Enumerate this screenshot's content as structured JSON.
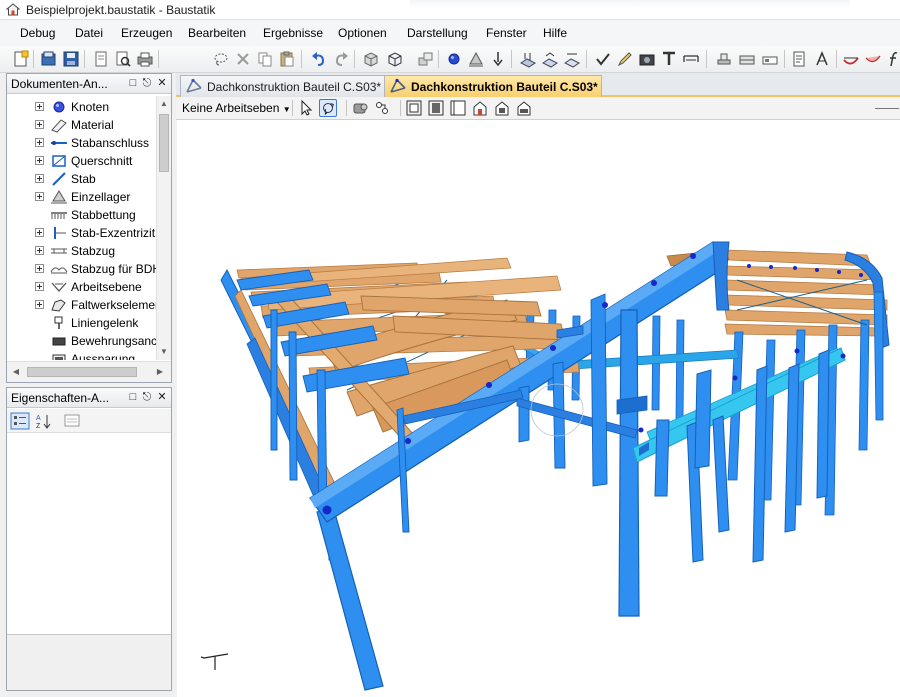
{
  "window": {
    "title": "Beispielprojekt.baustatik - Baustatik"
  },
  "menu": {
    "items": [
      "Debug",
      "Datei",
      "Erzeugen",
      "Bearbeiten",
      "Ergebnisse",
      "Optionen",
      "Darstellung",
      "Fenster",
      "Hilfe"
    ]
  },
  "toolbar": {
    "icons": [
      "new-icon",
      "open-icon",
      "save-icon",
      "page-icon",
      "print-preview-icon",
      "print-icon",
      "lasso-icon",
      "delete-icon",
      "copy-icon",
      "paste-icon",
      "undo-icon",
      "redo-icon",
      "box-icon",
      "view-cube-icon",
      "move-icon",
      "node-icon",
      "support-icon",
      "load-icon",
      "load-area-icon",
      "checkmark-icon",
      "pen-icon",
      "camera-icon",
      "text-icon",
      "dimension-icon",
      "plate-icon",
      "frame-icon",
      "document-icon",
      "design-icon",
      "curve-icon",
      "function-icon"
    ]
  },
  "document_panel": {
    "title": "Dokumenten-An...",
    "items": [
      {
        "label": "Knoten",
        "icon": "node-icon"
      },
      {
        "label": "Material",
        "icon": "material-icon"
      },
      {
        "label": "Stabanschluss",
        "icon": "member-end-icon"
      },
      {
        "label": "Querschnitt",
        "icon": "cross-section-icon"
      },
      {
        "label": "Stab",
        "icon": "member-icon"
      },
      {
        "label": "Einzellager",
        "icon": "single-support-icon"
      },
      {
        "label": "Stabbettung",
        "icon": "member-bedding-icon"
      },
      {
        "label": "Stab-Exzentrizit",
        "icon": "member-eccentricity-icon"
      },
      {
        "label": "Stabzug",
        "icon": "member-chain-icon"
      },
      {
        "label": "Stabzug für BDH",
        "icon": "member-chain-bdh-icon"
      },
      {
        "label": "Arbeitsebene",
        "icon": "work-plane-icon"
      },
      {
        "label": "Faltwerkselemen",
        "icon": "folded-plate-icon"
      },
      {
        "label": "Liniengelenk",
        "icon": "line-hinge-icon"
      },
      {
        "label": "Bewehrungsanc",
        "icon": "reinforcement-icon"
      },
      {
        "label": "Aussparung",
        "icon": "opening-icon"
      }
    ]
  },
  "properties_panel": {
    "title": "Eigenschaften-A...",
    "buttons": [
      "categorized-icon",
      "sort-az-icon",
      "property-pages-icon"
    ]
  },
  "tabs": [
    {
      "label": "Dachkonstruktion Bauteil C.S03*",
      "active": false
    },
    {
      "label": "Dachkonstruktion Bauteil C.S03*",
      "active": true
    }
  ],
  "view_toolbar": {
    "work_plane": "Keine Arbeitseben",
    "icons": [
      "pointer-icon",
      "orbit-icon",
      "render-icon",
      "rotate-icon",
      "view-front-icon",
      "view-back-icon",
      "view-left-icon",
      "view-right-icon",
      "view-top-icon",
      "view-iso-icon"
    ]
  },
  "viewport": {
    "content": "3d-steel-frame-model",
    "colors": {
      "frame": "#2f8ff0",
      "frame_dark": "#1d6fcf",
      "purlin": "#e0a56a",
      "purlin_dark": "#c98a4e",
      "bracing": "#4fd6f5",
      "node": "#1428c8"
    }
  }
}
